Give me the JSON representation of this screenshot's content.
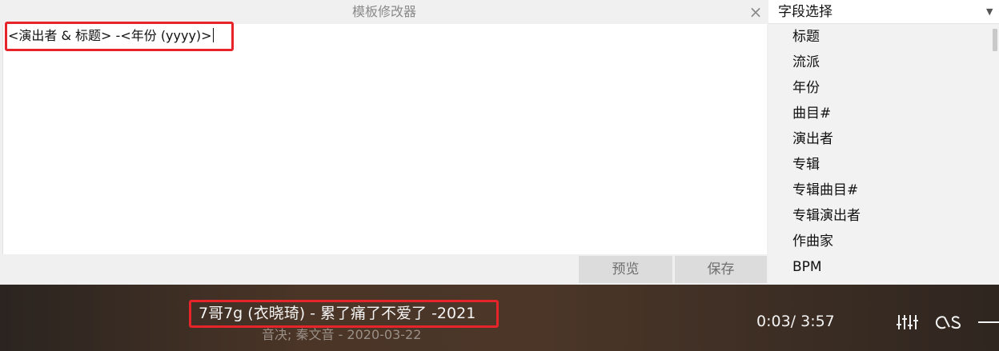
{
  "editor": {
    "title": "模板修改器",
    "close_label": "×",
    "template_text": "<演出者 & 标题> -<年份 (yyyy)>",
    "preview_label": "预览",
    "save_label": "保存"
  },
  "fields": {
    "select_label": "字段选择",
    "items": [
      "标题",
      "流派",
      "年份",
      "曲目#",
      "演出者",
      "专辑",
      "专辑曲目#",
      "专辑演出者",
      "作曲家",
      "BPM"
    ]
  },
  "player": {
    "title": "7哥7g (衣晓琦) - 累了痛了不爱了 -2021",
    "subtitle": "音决; 秦文音 - 2020-03-22",
    "time": "0:03/ 3:57",
    "icons": [
      "equalizer-icon",
      "lastfm-icon",
      "minimize-icon"
    ]
  },
  "colors": {
    "highlight": "#e8242b",
    "player_bg": "#4a3527"
  }
}
